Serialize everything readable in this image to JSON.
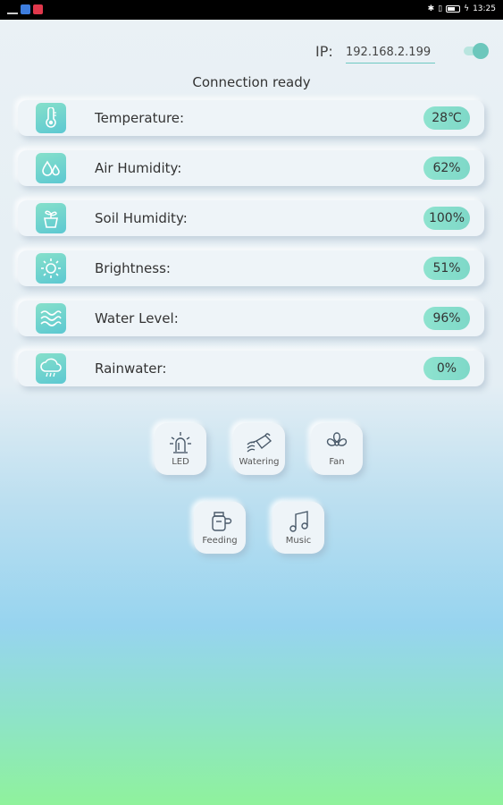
{
  "status_bar": {
    "time": "13:25",
    "battery": "90"
  },
  "connection": {
    "ip_label": "IP:",
    "ip_value": "192.168.2.199",
    "toggle_on": true,
    "status": "Connection ready"
  },
  "sensors": [
    {
      "label": "Temperature:",
      "value": "28℃",
      "icon": "thermometer-icon"
    },
    {
      "label": "Air Humidity:",
      "value": "62%",
      "icon": "droplets-icon"
    },
    {
      "label": "Soil Humidity:",
      "value": "100%",
      "icon": "plant-pot-icon"
    },
    {
      "label": "Brightness:",
      "value": "51%",
      "icon": "sun-icon"
    },
    {
      "label": "Water Level:",
      "value": "96%",
      "icon": "waves-icon"
    },
    {
      "label": "Rainwater:",
      "value": "0%",
      "icon": "rain-cloud-icon"
    }
  ],
  "controls": [
    {
      "label": "LED",
      "icon": "led-icon"
    },
    {
      "label": "Watering",
      "icon": "watering-can-icon"
    },
    {
      "label": "Fan",
      "icon": "fan-icon"
    },
    {
      "label": "Feeding",
      "icon": "feeding-icon"
    },
    {
      "label": "Music",
      "icon": "music-note-icon"
    }
  ],
  "colors": {
    "accent": "#6cc7bc",
    "icon_bg": "#7bd5cc",
    "value_pill": "#8ee3cf"
  }
}
